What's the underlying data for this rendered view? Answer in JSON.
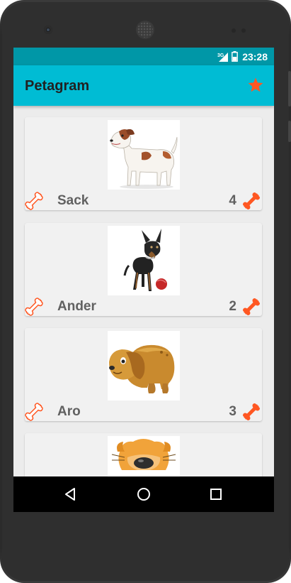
{
  "status_bar": {
    "network": "3G",
    "time": "23:28"
  },
  "app_bar": {
    "title": "Petagram",
    "favorites_icon": "star-icon"
  },
  "pets": [
    {
      "name": "Sack",
      "likes": "4",
      "photo": "jack-russell-terrier"
    },
    {
      "name": "Ander",
      "likes": "2",
      "photo": "miniature-pinscher-with-ball"
    },
    {
      "name": "Aro",
      "likes": "3",
      "photo": "cartoon-brown-puppy"
    },
    {
      "name": "",
      "likes": "",
      "photo": "cartoon-dog-face"
    }
  ],
  "icons": {
    "like": "bone-outline-icon",
    "rating": "bone-filled-icon"
  },
  "colors": {
    "status_bar": "#0097a7",
    "app_bar": "#00bcd4",
    "accent": "#ff5722",
    "card": "#f1f1f1",
    "text": "#616161"
  },
  "nav_bar": {
    "back": "back-icon",
    "home": "home-icon",
    "recents": "recents-icon"
  }
}
